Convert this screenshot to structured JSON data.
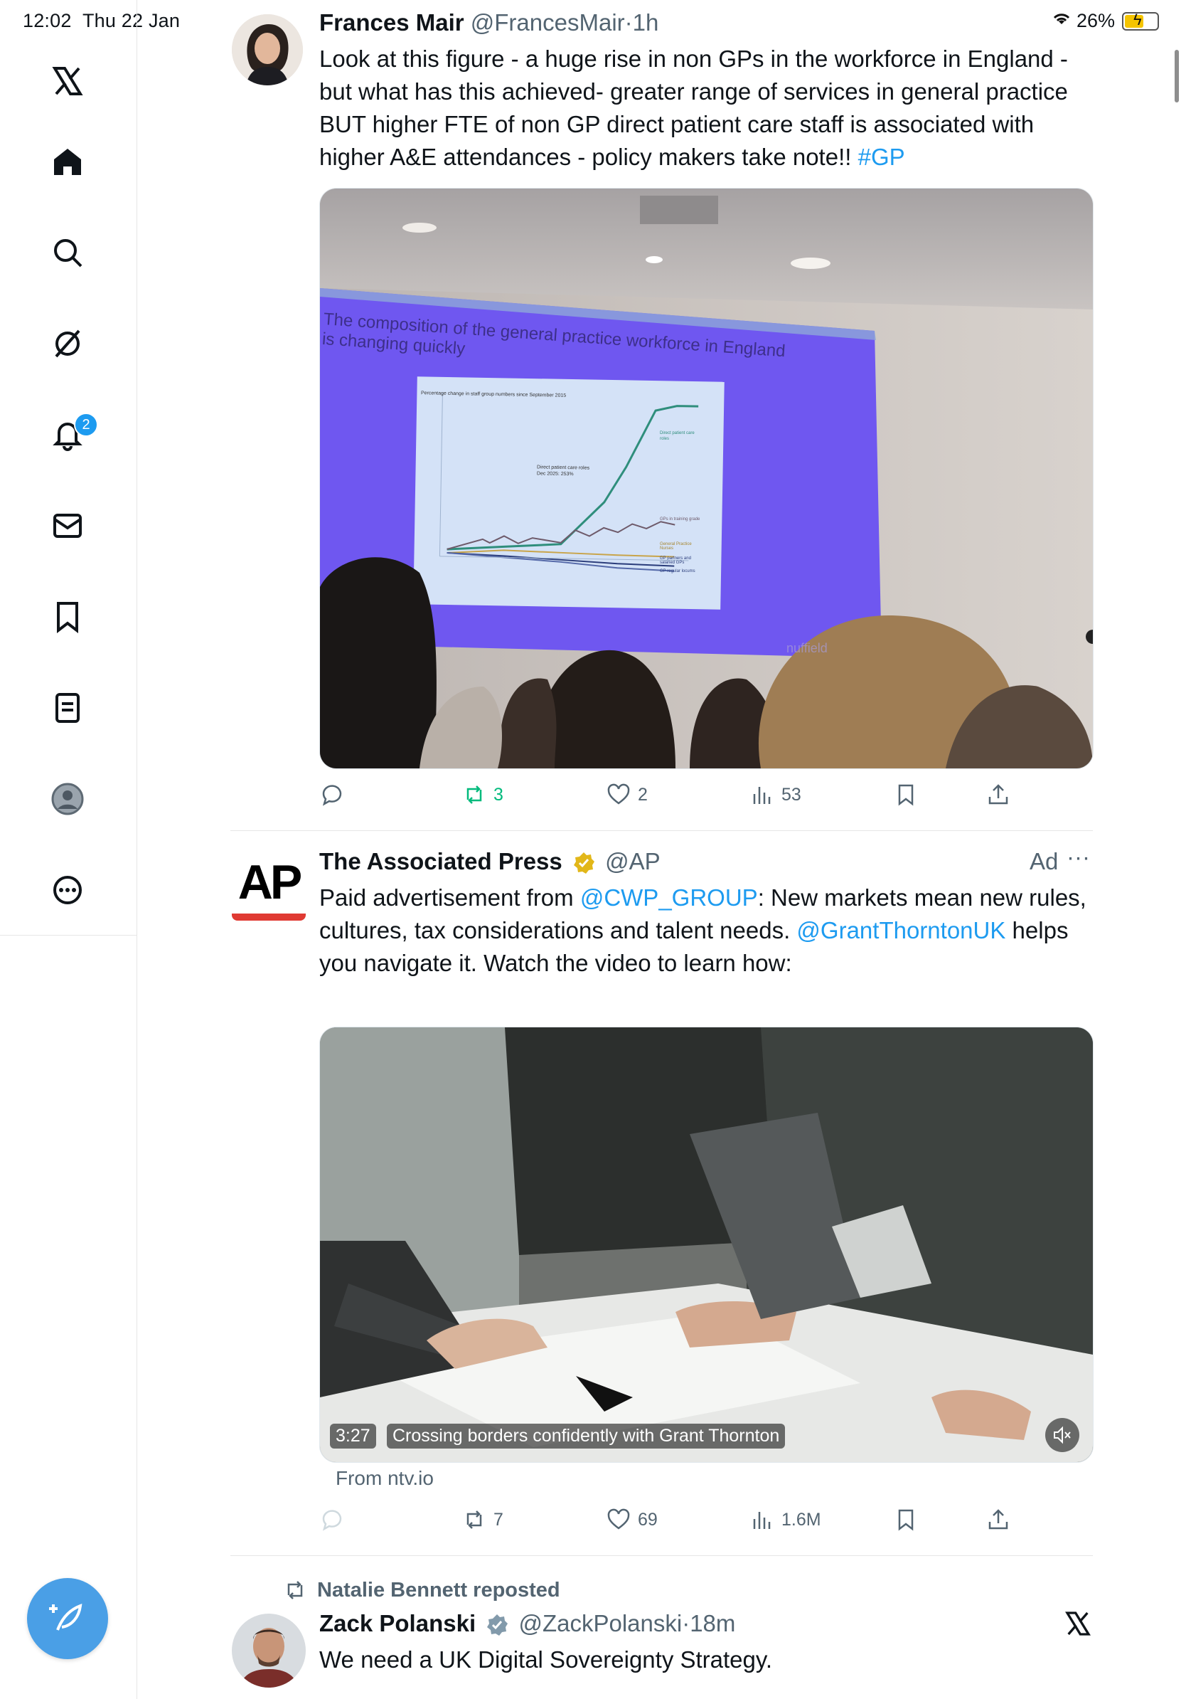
{
  "status_bar": {
    "time": "12:02",
    "date": "Thu 22 Jan",
    "battery": "26%"
  },
  "sidebar": {
    "items": [
      {
        "name": "x-logo-icon"
      },
      {
        "name": "home-icon"
      },
      {
        "name": "search-icon"
      },
      {
        "name": "grok-icon"
      },
      {
        "name": "notifications-icon"
      },
      {
        "name": "messages-icon"
      },
      {
        "name": "bookmarks-icon"
      },
      {
        "name": "lists-icon"
      },
      {
        "name": "profile-icon"
      },
      {
        "name": "more-icon"
      }
    ],
    "notification_count": "2",
    "compose_icon": "feather-plus-icon"
  },
  "tweets": [
    {
      "author": "Frances Mair",
      "handle": "@FrancesMair",
      "sep": "·",
      "time": "1h",
      "text": "Look at this figure - a huge rise in non GPs in the workforce in England - but what has this achieved- greater range of services in general practice BUT higher FTE of non GP direct patient care staff is associated with higher A&E attendances - policy makers take note!!",
      "hashtag": "#GP",
      "slide": {
        "title_line1": "The composition of the general practice workforce in England",
        "title_line2": "is changing quickly",
        "chart_title": "Percentage change in staff group numbers since September 2015",
        "callout_line1": "Direct patient care roles",
        "callout_line2": "Dec 2025: 253%",
        "series_labels": [
          "Direct patient care roles",
          "GPs in training grade",
          "General Practice Nurses",
          "GP partners and salaried GPs",
          "GP regular locums"
        ],
        "watermark": "nuffield"
      },
      "stats": {
        "replies": "",
        "reposts": "3",
        "likes": "2",
        "views": "53"
      }
    },
    {
      "author": "The Associated Press",
      "handle": "@AP",
      "ad_label": "Ad",
      "more": "···",
      "logo_text": "AP",
      "text_prefix": "Paid advertisement from ",
      "mention1": "@CWP_GROUP",
      "text_mid": ": New markets mean new rules, cultures, tax considerations and talent needs. ",
      "mention2": "@GrantThorntonUK",
      "text_end": " helps you navigate it. Watch the video to learn how:",
      "video": {
        "duration": "3:27",
        "caption": "Crossing borders confidently with Grant Thornton"
      },
      "source": "From ntv.io",
      "stats": {
        "replies": "",
        "reposts": "7",
        "likes": "69",
        "views": "1.6M"
      }
    },
    {
      "repost_label": "Natalie Bennett reposted",
      "author": "Zack Polanski",
      "handle": "@ZackPolanski",
      "sep": "·",
      "time": "18m",
      "text": "We need a UK Digital Sovereignty Strategy."
    }
  ],
  "colors": {
    "accent": "#1d9bf0",
    "repost_green": "#00ba7c",
    "slide_purple": "#6f57f0",
    "verified_gold": "#e2b719"
  }
}
